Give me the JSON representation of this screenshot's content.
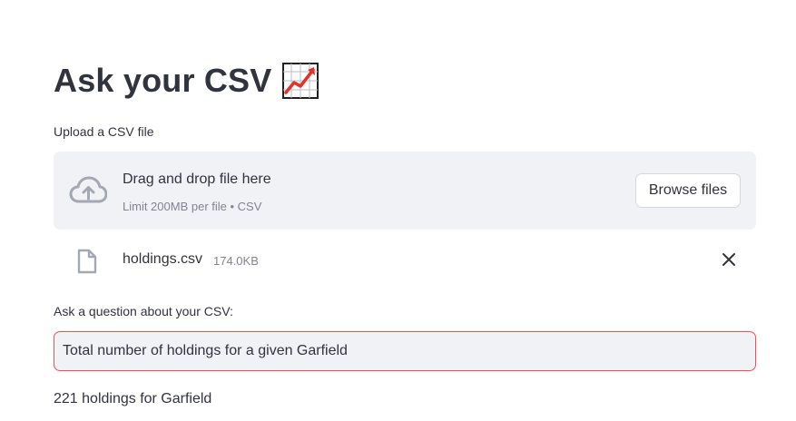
{
  "header": {
    "title": "Ask your CSV",
    "title_icon": "chart-increasing-icon"
  },
  "uploader": {
    "label": "Upload a CSV file",
    "drop_text": "Drag and drop file here",
    "limit_text": "Limit 200MB per file • CSV",
    "browse_label": "Browse files",
    "icon": "cloud-upload-icon"
  },
  "uploaded_file": {
    "name": "holdings.csv",
    "size": "174.0KB",
    "icon": "file-icon",
    "remove_icon": "close-icon"
  },
  "question": {
    "label": "Ask a question about your CSV:",
    "value": "Total number of holdings for a given Garfield"
  },
  "answer": {
    "text": "221 holdings for Garfield"
  },
  "colors": {
    "text": "#31333f",
    "muted": "#808495",
    "panel_bg": "#f0f2f6",
    "accent_border": "#ff4b4b",
    "icon_gray": "#a3a8b4"
  }
}
